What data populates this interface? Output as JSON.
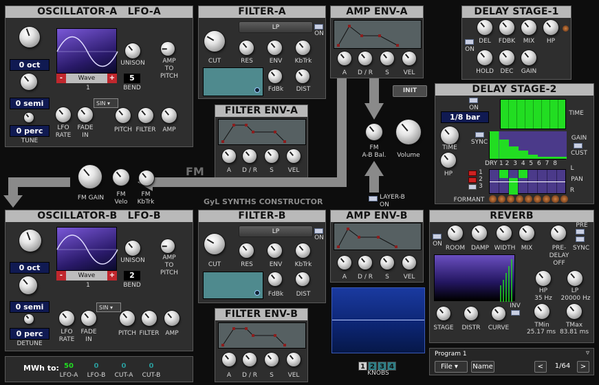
{
  "osc_a": {
    "title": "OSCILLATOR-A",
    "lfo": "LFO-A",
    "wave": "Wave",
    "minus": "-",
    "plus": "+",
    "wave_num": "1",
    "bend_val": "5",
    "oct": "0 oct",
    "semi": "0 semi",
    "perc": "0 perc",
    "tune": "TUNE",
    "unison": "UNISON",
    "amp_to_pitch": "AMP\nTO\nPITCH",
    "lfo_shape": "SIN",
    "lfo_rate": "LFO\nRATE",
    "fade_in": "FADE\nIN",
    "pitch": "PITCH",
    "filter": "FILTER",
    "amp": "AMP",
    "bend": "BEND"
  },
  "osc_b": {
    "title": "OSCILLATOR-B",
    "lfo": "LFO-B",
    "wave": "Wave",
    "minus": "-",
    "plus": "+",
    "wave_num": "1",
    "bend_val": "2",
    "oct": "0 oct",
    "semi": "0 semi",
    "perc": "0 perc",
    "detune": "DETUNE",
    "unison": "UNISON",
    "amp_to_pitch": "AMP\nTO\nPITCH",
    "lfo_shape": "SIN",
    "lfo_rate": "LFO\nRATE",
    "fade_in": "FADE\nIN",
    "pitch": "PITCH",
    "filter": "FILTER",
    "amp": "AMP",
    "bend": "BEND"
  },
  "filter_a": {
    "title": "FILTER-A",
    "mode": "LP",
    "on": "ON",
    "cut": "CUT",
    "res": "RES",
    "env": "ENV",
    "kbtrk": "KbTrk",
    "fdbk": "FdBk",
    "dist": "DIST"
  },
  "filter_b": {
    "title": "FILTER-B",
    "mode": "LP",
    "on": "ON",
    "cut": "CUT",
    "res": "RES",
    "env": "ENV",
    "kbtrk": "KbTrk",
    "fdbk": "FdBk",
    "dist": "DIST"
  },
  "filter_env_a": {
    "title": "FILTER ENV-A",
    "a": "A",
    "dr": "D / R",
    "s": "S",
    "vel": "VEL"
  },
  "filter_env_b": {
    "title": "FILTER ENV-B",
    "a": "A",
    "dr": "D / R",
    "s": "S",
    "vel": "VEL"
  },
  "amp_env_a": {
    "title": "AMP ENV-A",
    "a": "A",
    "dr": "D / R",
    "s": "S",
    "vel": "VEL"
  },
  "amp_env_b": {
    "title": "AMP ENV-B",
    "a": "A",
    "dr": "D / R",
    "s": "S",
    "vel": "VEL"
  },
  "center": {
    "init": "INIT",
    "fm_ab": "FM\nA-B Bal.",
    "volume": "Volume",
    "layer_b": "LAYER-B\nON",
    "fm": "FM",
    "fm_gain": "FM GAIN",
    "fm_velo": "FM\nVelo",
    "fm_kbtrk": "FM\nKbTrk",
    "brand": "GyL SYNTHS CONSTRUCTOR",
    "knobs": "KNOBS",
    "knob_pages": [
      "1",
      "2",
      "3",
      "4"
    ]
  },
  "delay1": {
    "title": "DELAY STAGE-1",
    "on": "ON",
    "del": "DEL",
    "fdbk": "FDBK",
    "mix": "MIX",
    "hp": "HP",
    "hold": "HOLD",
    "dec": "DEC",
    "gain": "GAIN"
  },
  "delay2": {
    "title": "DELAY STAGE-2",
    "on": "ON",
    "time_val": "1/8 bar",
    "time": "TIME",
    "sync": "SYNC",
    "hp": "HP",
    "time_right": "TIME",
    "gain_label": "GAIN",
    "cust": "CUST",
    "dry": "DRY",
    "steps": [
      "1",
      "2",
      "3",
      "4",
      "5",
      "6",
      "7",
      "8"
    ],
    "l": "L",
    "pan": "PAN",
    "r": "R",
    "formant": "FORMANT",
    "rows": [
      "1",
      "2",
      "3"
    ]
  },
  "reverb": {
    "title": "REVERB",
    "pre": "PRE",
    "on": "ON",
    "room": "ROOM",
    "damp": "DAMP",
    "width": "WIDTH",
    "mix": "MIX",
    "pre_delay": "PRE-\nDELAY\nOFF",
    "sync": "SYNC",
    "hp": "HP",
    "hp_val": "35 Hz",
    "lp": "LP",
    "lp_val": "20000 Hz",
    "stage": "STAGE",
    "distr": "DISTR",
    "curve": "CURVE",
    "inv": "INV",
    "tmin": "TMin",
    "tmin_val": "25.17 ms",
    "tmax": "TMax",
    "tmax_val": "83.81 ms"
  },
  "mwh": {
    "label": "MWh to:",
    "targets": [
      {
        "val": "50",
        "name": "LFO-A"
      },
      {
        "val": "0",
        "name": "LFO-B"
      },
      {
        "val": "0",
        "name": "CUT-A"
      },
      {
        "val": "0",
        "name": "CUT-B"
      }
    ]
  },
  "program": {
    "name": "Program 1",
    "file": "File",
    "name_btn": "Name",
    "prev": "<",
    "next": ">",
    "page": "1/64",
    "menu": "▿"
  },
  "colors": {
    "accent_blue": "#101a52",
    "green_bar": "#22dd22",
    "purple": "#4b3a8a",
    "led_red": "#cc2222"
  }
}
